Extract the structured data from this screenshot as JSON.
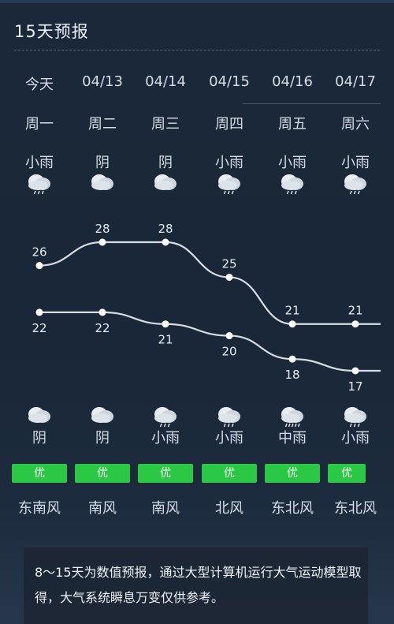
{
  "title": "15天预报",
  "days": [
    {
      "date": "今天",
      "weekday": "周一",
      "day_weather": "小雨",
      "day_icon": "light-rain-icon",
      "high": 26,
      "low": 22,
      "night_weather": "阴",
      "night_icon": "overcast-icon",
      "aqi": "优",
      "wind": "东南风"
    },
    {
      "date": "04/13",
      "weekday": "周二",
      "day_weather": "阴",
      "day_icon": "overcast-icon",
      "high": 28,
      "low": 22,
      "night_weather": "阴",
      "night_icon": "overcast-icon",
      "aqi": "优",
      "wind": "南风"
    },
    {
      "date": "04/14",
      "weekday": "周三",
      "day_weather": "阴",
      "day_icon": "overcast-icon",
      "high": 28,
      "low": 21,
      "night_weather": "小雨",
      "night_icon": "light-rain-icon",
      "aqi": "优",
      "wind": "南风"
    },
    {
      "date": "04/15",
      "weekday": "周四",
      "day_weather": "小雨",
      "day_icon": "light-rain-icon",
      "high": 25,
      "low": 20,
      "night_weather": "小雨",
      "night_icon": "light-rain-icon",
      "aqi": "优",
      "wind": "北风"
    },
    {
      "date": "04/16",
      "weekday": "周五",
      "day_weather": "小雨",
      "day_icon": "light-rain-icon",
      "high": 21,
      "low": 18,
      "night_weather": "中雨",
      "night_icon": "moderate-rain-icon",
      "aqi": "优",
      "wind": "东北风"
    },
    {
      "date": "04/17",
      "weekday": "周六",
      "day_weather": "小雨",
      "day_icon": "light-rain-icon",
      "high": 21,
      "low": 17,
      "night_weather": "小雨",
      "night_icon": "light-rain-icon",
      "aqi": "优",
      "wind": "东北风"
    }
  ],
  "notice": "8～15天为数值预报，通过大型计算机运行大气运动模型取得，大气系统瞬息万变仅供参考。",
  "colors": {
    "aqi_good": "#2bc845",
    "line": "#d9dde2",
    "background": "#1a2737"
  }
}
